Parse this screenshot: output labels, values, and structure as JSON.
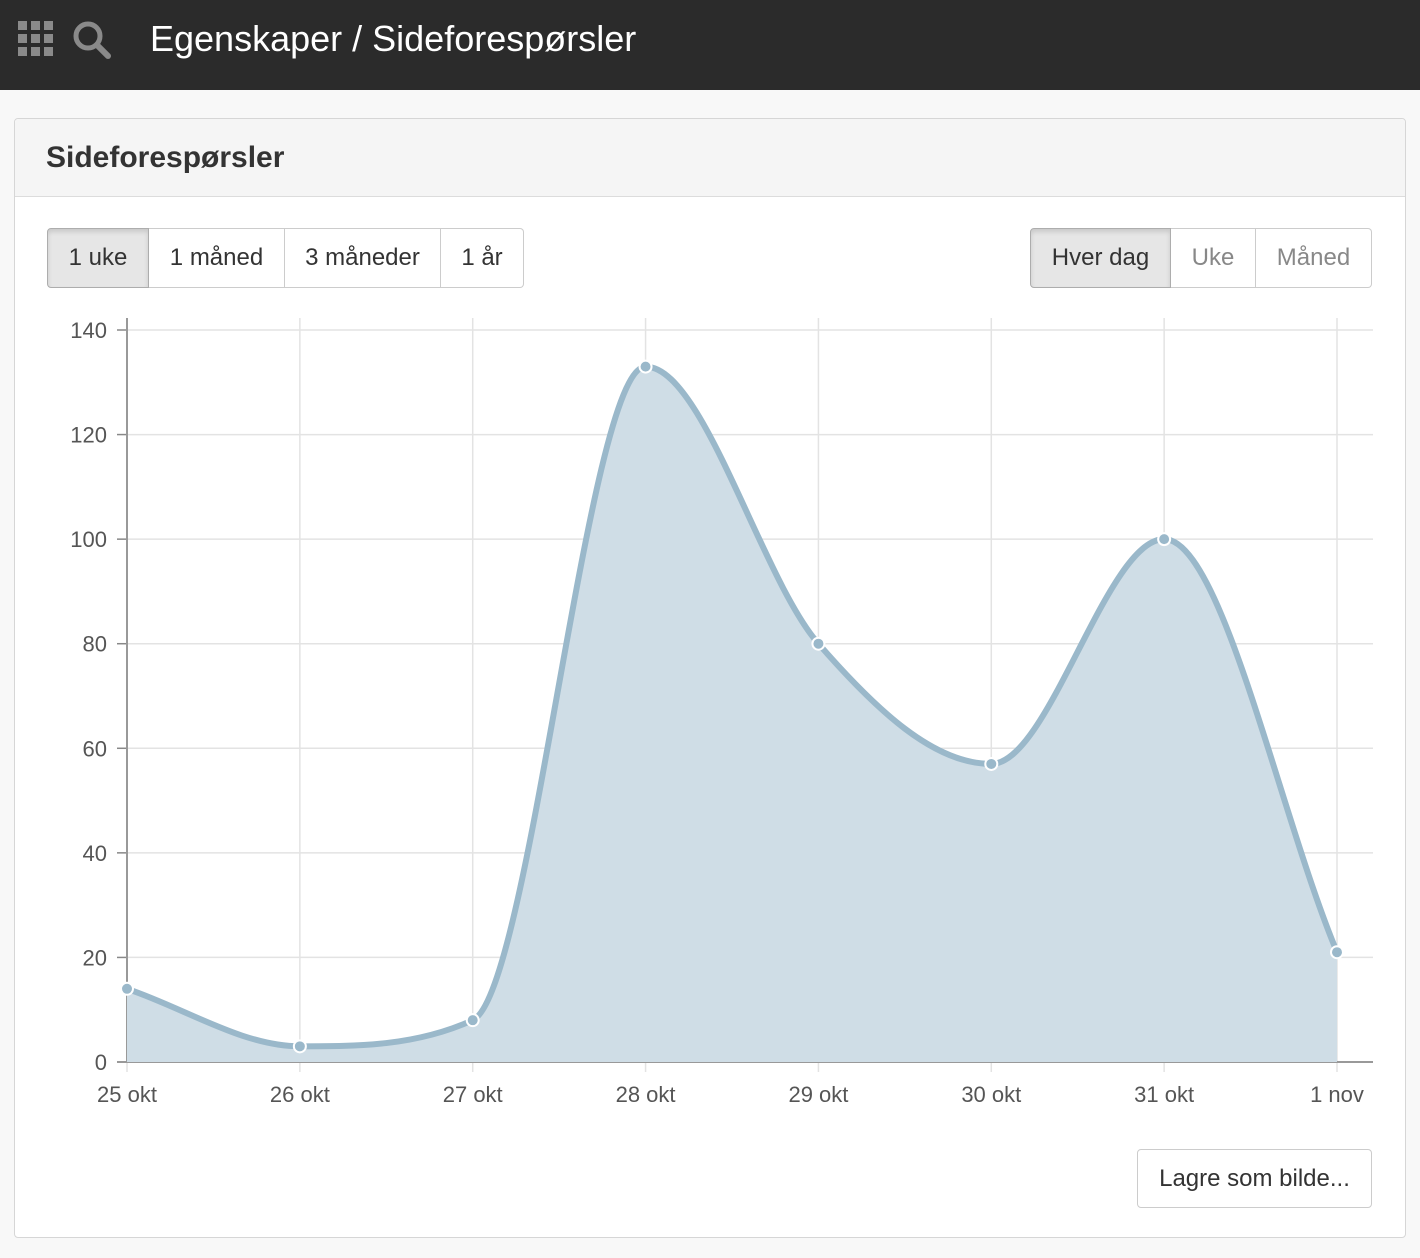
{
  "topbar": {
    "title": "Egenskaper / Sideforespørsler",
    "apps_icon": "grid-icon",
    "search_icon": "search-icon",
    "background": "#2b2b2b"
  },
  "panel": {
    "title": "Sideforespørsler",
    "range_buttons": [
      {
        "label": "1 uke",
        "active": true
      },
      {
        "label": "1 måned",
        "active": false
      },
      {
        "label": "3 måneder",
        "active": false
      },
      {
        "label": "1 år",
        "active": false
      }
    ],
    "interval_buttons": [
      {
        "label": "Hver dag",
        "active": true,
        "enabled": true
      },
      {
        "label": "Uke",
        "active": false,
        "enabled": false
      },
      {
        "label": "Måned",
        "active": false,
        "enabled": false
      }
    ],
    "save_label": "Lagre som bilde..."
  },
  "chart_data": {
    "type": "area",
    "categories": [
      "25 okt",
      "26 okt",
      "27 okt",
      "28 okt",
      "29 okt",
      "30 okt",
      "31 okt",
      "1 nov"
    ],
    "series": [
      {
        "values": [
          14,
          3,
          8,
          133,
          80,
          57,
          100,
          21
        ]
      }
    ],
    "ylim": [
      0,
      140
    ],
    "yticks": [
      0,
      20,
      40,
      60,
      80,
      100,
      120,
      140
    ],
    "grid": true,
    "line_color": "#9ab8ca",
    "fill_color": "#cfdde6"
  }
}
